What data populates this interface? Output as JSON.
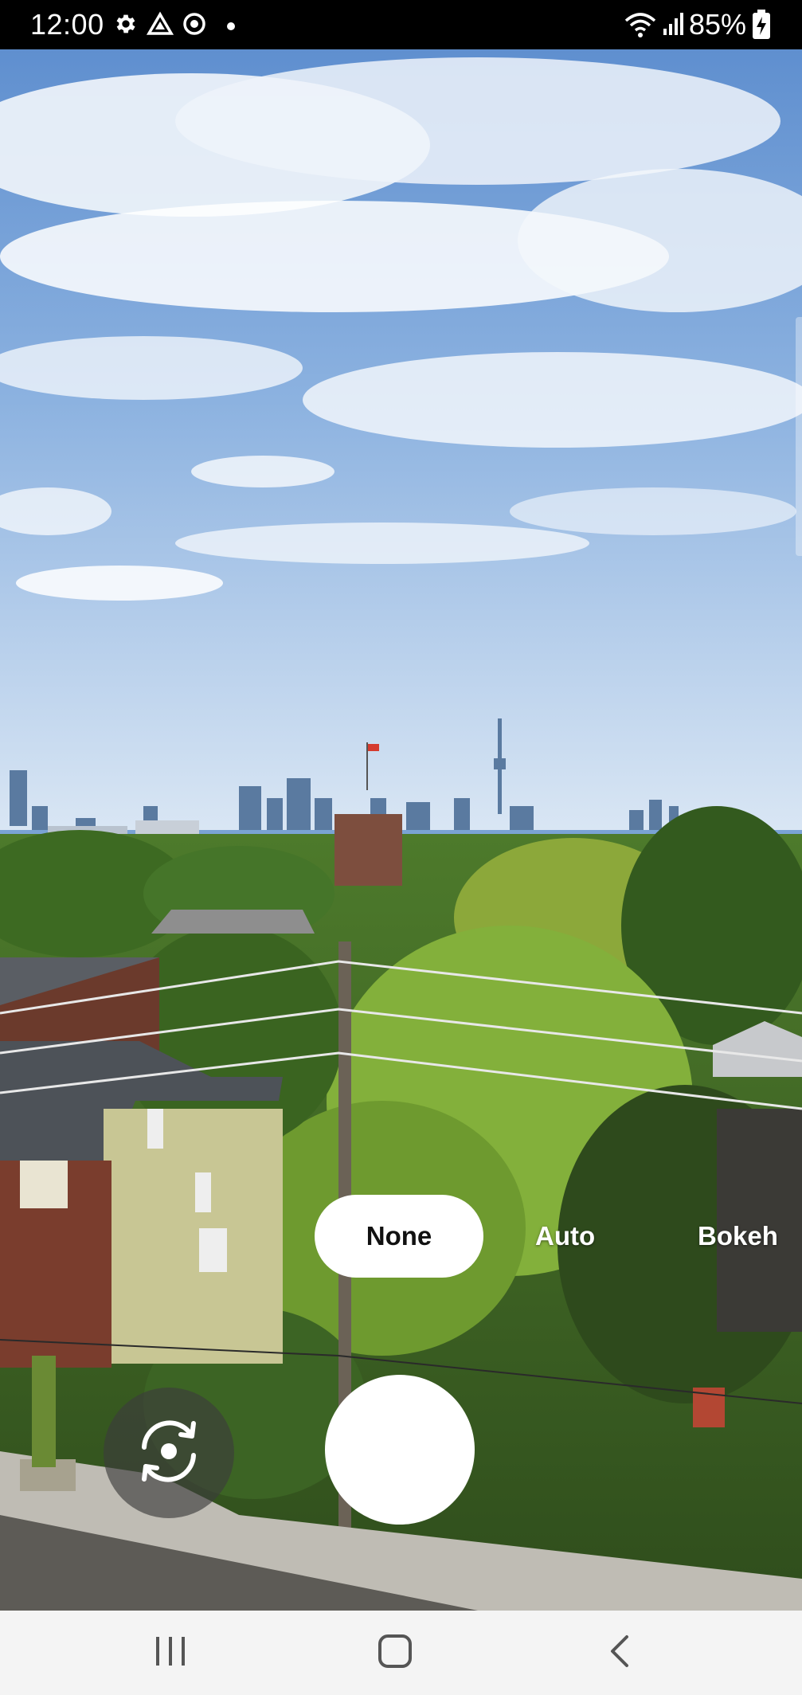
{
  "status_bar": {
    "time": "12:00",
    "left_icons": [
      "gear-icon",
      "prime-video-icon",
      "sync-icon",
      "dot-icon"
    ],
    "right_icons": [
      "wifi-icon",
      "signal-icon",
      "battery-charging-icon"
    ],
    "battery": "85%"
  },
  "camera": {
    "modes": [
      "None",
      "Auto",
      "Bokeh"
    ],
    "selected_mode": "None",
    "controls": [
      "flip-camera-icon",
      "shutter-button"
    ]
  },
  "navigation": {
    "buttons": [
      "recent-apps-icon",
      "home-icon",
      "back-icon"
    ]
  },
  "colors": {
    "pill_bg": "#ffffff",
    "nav_bar_bg": "#f4f4f4",
    "status_bar_bg": "#000000"
  }
}
